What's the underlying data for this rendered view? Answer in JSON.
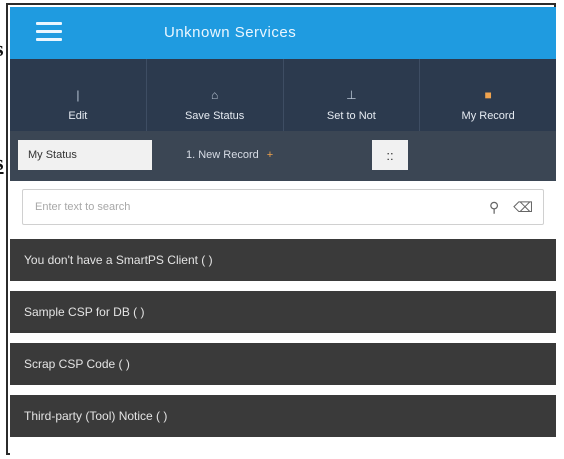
{
  "side": {
    "s1": "s",
    "s2": "s"
  },
  "app": {
    "title": "Unknown Services"
  },
  "toolbar": {
    "items": [
      {
        "label": "Edit",
        "icon": "edit-icon"
      },
      {
        "label": "Save Status",
        "icon": "save-icon"
      },
      {
        "label": "Set to Not",
        "icon": "flag-icon"
      },
      {
        "label": "My Record",
        "icon": "record-icon"
      }
    ]
  },
  "tabs": {
    "active": "My Status",
    "second": "1. New Record",
    "second_badge": "+",
    "pin": "::"
  },
  "search": {
    "placeholder": "Enter text to search"
  },
  "list": {
    "rows": [
      "You don't have a SmartPS Client ( )",
      "Sample CSP for DB ( )",
      "Scrap CSP Code ( )",
      "Third-party (Tool) Notice ( )"
    ]
  },
  "colors": {
    "titlebar": "#1f9be0",
    "toolbar": "#2c3a4e",
    "tabs": "#3b4654",
    "row": "#3a3a3a",
    "accent": "#f0a34e"
  }
}
